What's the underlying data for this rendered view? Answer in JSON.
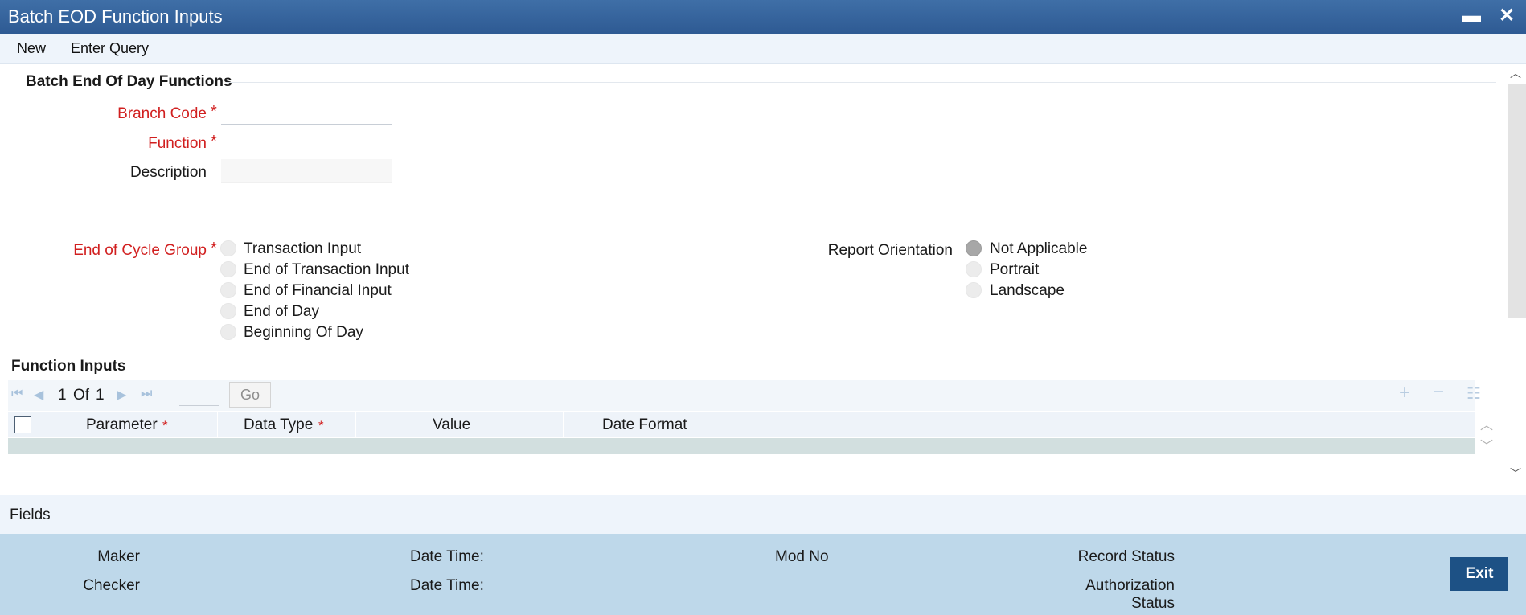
{
  "window": {
    "title": "Batch EOD Function Inputs",
    "minimize_glyph": "▬",
    "close_glyph": "✕"
  },
  "menu": {
    "new": "New",
    "enter_query": "Enter Query"
  },
  "section": {
    "title": "Batch End Of Day Functions"
  },
  "form": {
    "branch_code_label": "Branch Code",
    "function_label": "Function",
    "description_label": "Description",
    "required_mark": "*",
    "branch_code_value": "",
    "function_value": "",
    "description_value": ""
  },
  "eoc_group": {
    "label": "End of Cycle Group",
    "options": [
      "Transaction Input",
      "End of Transaction Input",
      "End of Financial Input",
      "End of Day",
      "Beginning Of Day"
    ],
    "selected": null
  },
  "report_orientation": {
    "label": "Report Orientation",
    "options": [
      "Not Applicable",
      "Portrait",
      "Landscape"
    ],
    "selected": "Not Applicable"
  },
  "function_inputs": {
    "title": "Function Inputs",
    "pager": {
      "current": "1",
      "of_label": "Of",
      "total": "1",
      "go_label": "Go"
    },
    "columns": {
      "parameter": "Parameter",
      "data_type": "Data Type",
      "value": "Value",
      "date_format": "Date Format"
    },
    "rows": []
  },
  "fields_label": "Fields",
  "footer": {
    "maker": "Maker",
    "checker": "Checker",
    "date_time": "Date Time:",
    "mod_no": "Mod No",
    "record_status": "Record Status",
    "authorization": "Authorization",
    "status": "Status",
    "exit": "Exit"
  },
  "colors": {
    "title_bar": "#2e5a93",
    "required": "#d11f1f",
    "footer": "#bed8ea",
    "exit_button": "#1d5185"
  }
}
